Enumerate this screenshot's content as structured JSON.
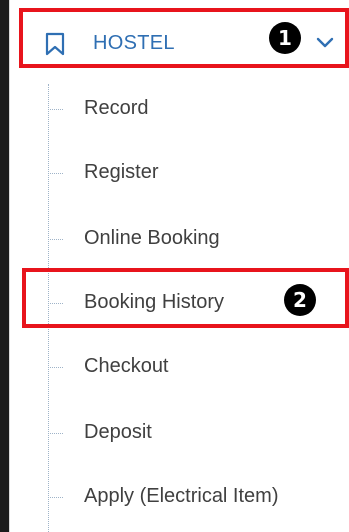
{
  "menu": {
    "header": {
      "label": "HOSTEL",
      "icon": "bookmark-icon",
      "expand_icon": "chevron-down-icon",
      "accent_color": "#2f6fb3"
    },
    "items": [
      {
        "label": "Record"
      },
      {
        "label": "Register"
      },
      {
        "label": "Online Booking"
      },
      {
        "label": "Booking History"
      },
      {
        "label": "Checkout"
      },
      {
        "label": "Deposit"
      },
      {
        "label": "Apply (Electrical Item)"
      }
    ]
  },
  "annotations": {
    "highlight_color": "#e8141c",
    "callouts": [
      {
        "number": "1",
        "target": "HOSTEL"
      },
      {
        "number": "2",
        "target": "Booking History"
      }
    ]
  }
}
